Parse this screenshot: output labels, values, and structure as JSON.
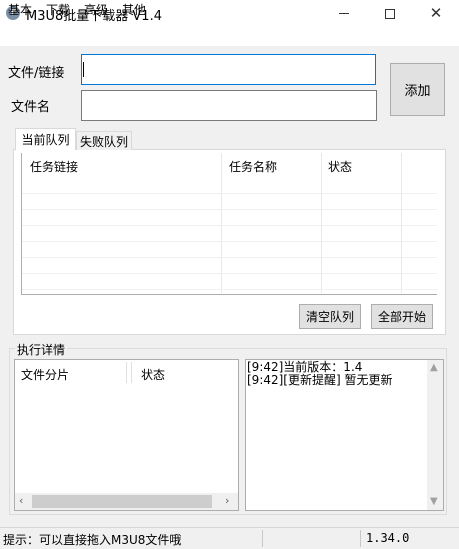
{
  "window": {
    "title": "M3U8批量下载器  V1.4",
    "icons": {
      "app": "download-arrow-icon",
      "minimize": "minimize-icon",
      "maximize": "maximize-icon",
      "close": "close-icon"
    }
  },
  "menu": [
    "基本",
    "下载",
    "高级",
    "其他"
  ],
  "form": {
    "file_label": "文件/链接",
    "file_value": "",
    "name_label": "文件名",
    "name_value": "",
    "add_button": "添加"
  },
  "tabs": [
    "当前队列",
    "失败队列"
  ],
  "queue": {
    "columns": [
      "任务链接",
      "任务名称",
      "状态"
    ],
    "rows": [],
    "clear_button": "清空队列",
    "start_all_button": "全部开始"
  },
  "exec": {
    "title": "执行详情",
    "segment_columns": [
      "文件分片",
      "状态"
    ],
    "log": [
      "[9:42]当前版本：1.4",
      "[9:42][更新提醒] 暂无更新"
    ]
  },
  "status": {
    "hint": "提示：可以直接拖入M3U8文件哦",
    "version": "1.34.0"
  },
  "colors": {
    "accent_border": "#0078d7",
    "button_bg": "#e1e1e1",
    "window_bg": "#f0f0f0"
  }
}
